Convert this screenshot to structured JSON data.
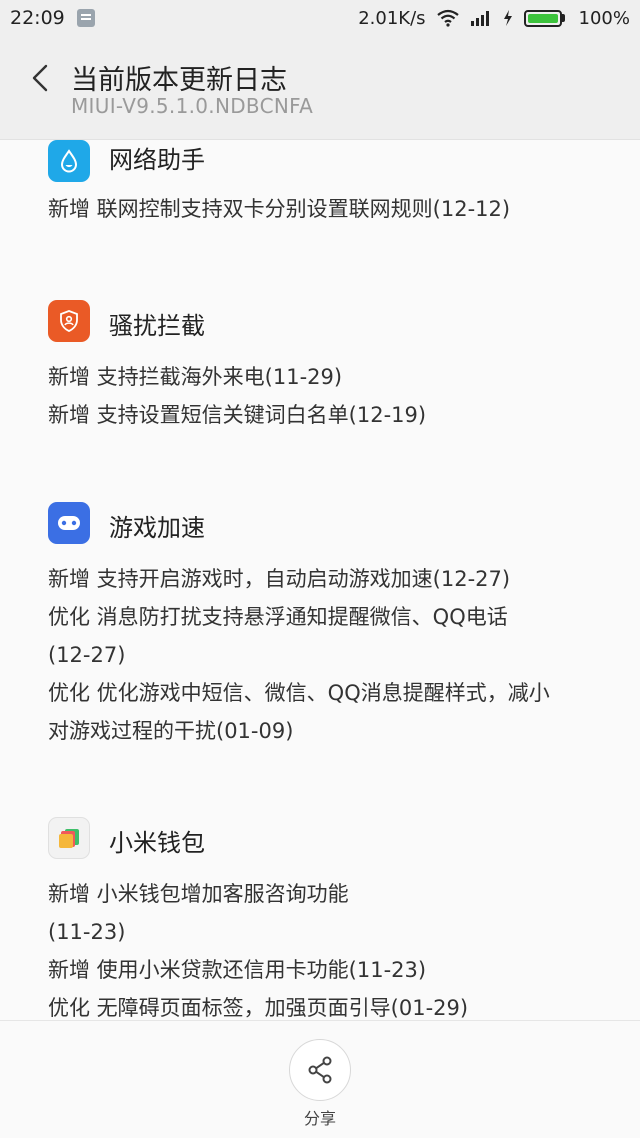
{
  "status_bar": {
    "time": "22:09",
    "net_speed": "2.01K/s",
    "battery_pct": "100%",
    "battery_level": 1.0,
    "icons": [
      "notification-icon",
      "wifi-icon",
      "signal-icon",
      "charging-icon",
      "battery-icon"
    ]
  },
  "header": {
    "title": "当前版本更新日志",
    "subtitle": "MIUI-V9.5.1.0.NDBCNFA"
  },
  "sections": [
    {
      "name": "网络助手",
      "icon": "water-drop-icon",
      "icon_color": "#1fa8e8",
      "lines": [
        "新增 联网控制支持双卡分别设置联网规则(12-12)"
      ]
    },
    {
      "name": "骚扰拦截",
      "icon": "shield-icon",
      "icon_color": "#ea5a26",
      "lines": [
        "新增 支持拦截海外来电(11-29)",
        "新增 支持设置短信关键词白名单(12-19)"
      ]
    },
    {
      "name": "游戏加速",
      "icon": "gamepad-icon",
      "icon_color": "#3b6fe4",
      "lines": [
        "新增 支持开启游戏时，自动启动游戏加速(12-27)",
        "优化 消息防打扰支持悬浮通知提醒微信、QQ电话",
        "(12-27)",
        "优化 优化游戏中短信、微信、QQ消息提醒样式，减小",
        "对游戏过程的干扰(01-09)"
      ]
    },
    {
      "name": "小米钱包",
      "icon": "wallet-icon",
      "icon_color": "#f2f2f2",
      "lines": [
        "新增 小米钱包增加客服咨询功能",
        "(11-23)",
        "新增 使用小米贷款还信用卡功能(11-23)",
        "优化 无障碍页面标签，加强页面引导(01-29)"
      ]
    }
  ],
  "bottom_bar": {
    "share_label": "分享",
    "share_icon": "share-icon"
  }
}
